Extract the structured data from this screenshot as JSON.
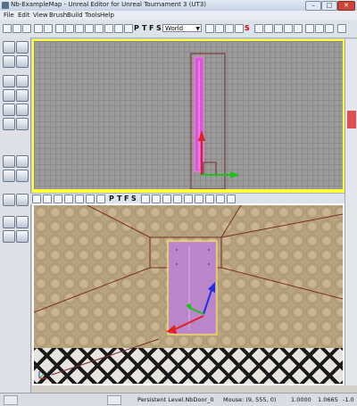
{
  "window": {
    "title": "Nb-ExampleMap - Unreal Editor for Unreal Tournament 3 (UT3)",
    "minimize": "–",
    "maximize": "□",
    "close": "✕"
  },
  "menu": [
    "File",
    "Edit",
    "View",
    "Brush",
    "Build",
    "Tools",
    "Help"
  ],
  "toolbar": {
    "coord_system": "World",
    "letters": [
      "P",
      "T",
      "F",
      "S"
    ],
    "s_label": "S"
  },
  "statusbar": {
    "level": "Persistent Level.NbDoor_0",
    "mouse": "Mouse: (9, 555, 0)",
    "value1": "1.0000",
    "value2": "1.0665",
    "value3": "-1.0"
  },
  "viewport_top": {
    "label": ""
  },
  "viewport_persp": {
    "label": ""
  },
  "colors": {
    "selection": "#ffff3a",
    "brush": "#d25ad2",
    "arrow_x": "#e02020",
    "arrow_y": "#20c020",
    "arrow_z": "#2030e0"
  }
}
